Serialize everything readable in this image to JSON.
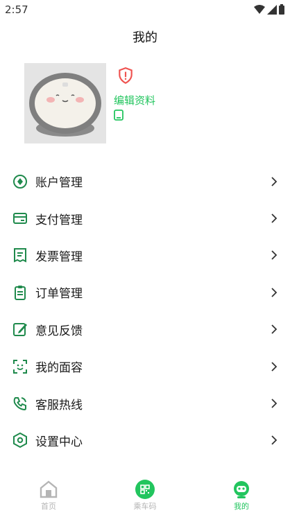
{
  "status_bar": {
    "time": "2:57"
  },
  "header": {
    "title": "我的"
  },
  "profile": {
    "edit_label": "编辑资料"
  },
  "menu": {
    "items": [
      {
        "icon": "account-icon",
        "label": "账户管理"
      },
      {
        "icon": "card-icon",
        "label": "支付管理"
      },
      {
        "icon": "invoice-icon",
        "label": "发票管理"
      },
      {
        "icon": "clipboard-icon",
        "label": "订单管理"
      },
      {
        "icon": "feedback-icon",
        "label": "意见反馈"
      },
      {
        "icon": "face-scan-icon",
        "label": "我的面容"
      },
      {
        "icon": "phone-icon",
        "label": "客服热线"
      },
      {
        "icon": "settings-hexagon-icon",
        "label": "设置中心"
      }
    ]
  },
  "tabbar": {
    "tabs": [
      {
        "icon": "home-icon",
        "label": "首页",
        "active": false
      },
      {
        "icon": "qr-code-icon",
        "label": "乘车码",
        "active": false
      },
      {
        "icon": "robot-face-icon",
        "label": "我的",
        "active": true
      }
    ]
  },
  "colors": {
    "accent": "#22c55e",
    "warning": "#ef5350",
    "inactive": "#b5b5b5"
  }
}
